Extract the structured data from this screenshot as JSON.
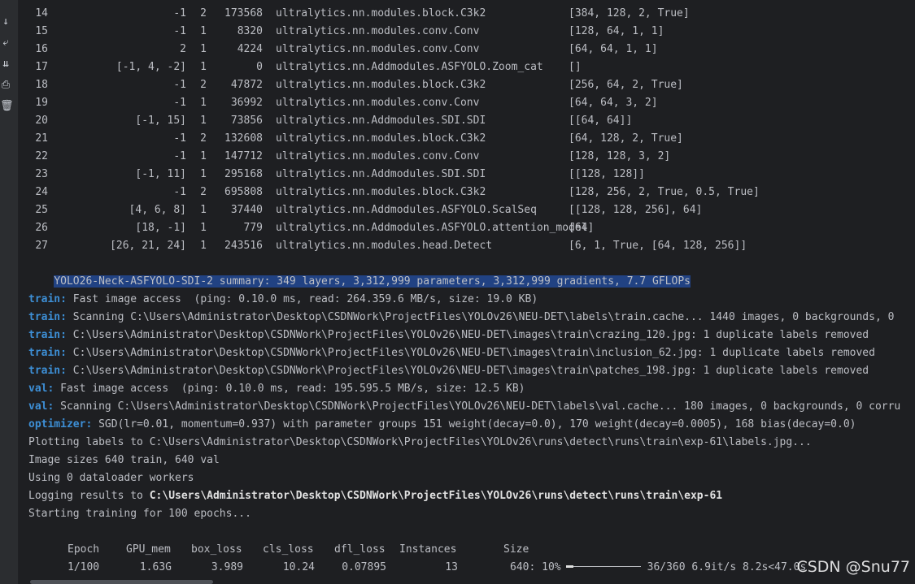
{
  "gutter_icons": [
    "arrow-down-icon",
    "wrap-lines-icon",
    "scroll-to-end-icon",
    "print-icon",
    "trash-icon"
  ],
  "model_rows": [
    {
      "idx": "14",
      "from": "-1",
      "n": "2",
      "params": "173568",
      "module": "ultralytics.nn.modules.block.C3k2",
      "args": "[384, 128, 2, True]"
    },
    {
      "idx": "15",
      "from": "-1",
      "n": "1",
      "params": "8320",
      "module": "ultralytics.nn.modules.conv.Conv",
      "args": "[128, 64, 1, 1]"
    },
    {
      "idx": "16",
      "from": "2",
      "n": "1",
      "params": "4224",
      "module": "ultralytics.nn.modules.conv.Conv",
      "args": "[64, 64, 1, 1]"
    },
    {
      "idx": "17",
      "from": "[-1, 4, -2]",
      "n": "1",
      "params": "0",
      "module": "ultralytics.nn.Addmodules.ASFYOLO.Zoom_cat",
      "args": "[]"
    },
    {
      "idx": "18",
      "from": "-1",
      "n": "2",
      "params": "47872",
      "module": "ultralytics.nn.modules.block.C3k2",
      "args": "[256, 64, 2, True]"
    },
    {
      "idx": "19",
      "from": "-1",
      "n": "1",
      "params": "36992",
      "module": "ultralytics.nn.modules.conv.Conv",
      "args": "[64, 64, 3, 2]"
    },
    {
      "idx": "20",
      "from": "[-1, 15]",
      "n": "1",
      "params": "73856",
      "module": "ultralytics.nn.Addmodules.SDI.SDI",
      "args": "[[64, 64]]"
    },
    {
      "idx": "21",
      "from": "-1",
      "n": "2",
      "params": "132608",
      "module": "ultralytics.nn.modules.block.C3k2",
      "args": "[64, 128, 2, True]"
    },
    {
      "idx": "22",
      "from": "-1",
      "n": "1",
      "params": "147712",
      "module": "ultralytics.nn.modules.conv.Conv",
      "args": "[128, 128, 3, 2]"
    },
    {
      "idx": "23",
      "from": "[-1, 11]",
      "n": "1",
      "params": "295168",
      "module": "ultralytics.nn.Addmodules.SDI.SDI",
      "args": "[[128, 128]]"
    },
    {
      "idx": "24",
      "from": "-1",
      "n": "2",
      "params": "695808",
      "module": "ultralytics.nn.modules.block.C3k2",
      "args": "[128, 256, 2, True, 0.5, True]"
    },
    {
      "idx": "25",
      "from": "[4, 6, 8]",
      "n": "1",
      "params": "37440",
      "module": "ultralytics.nn.Addmodules.ASFYOLO.ScalSeq",
      "args": "[[128, 128, 256], 64]"
    },
    {
      "idx": "26",
      "from": "[18, -1]",
      "n": "1",
      "params": "779",
      "module": "ultralytics.nn.Addmodules.ASFYOLO.attention_model",
      "args": "[64]"
    },
    {
      "idx": "27",
      "from": "[26, 21, 24]",
      "n": "1",
      "params": "243516",
      "module": "ultralytics.nn.modules.head.Detect",
      "args": "[6, 1, True, [64, 128, 256]]"
    }
  ],
  "summary": "YOLO26-Neck-ASFYOLO-SDI-2 summary: 349 layers, 3,312,999 parameters, 3,312,999 gradients, 7.7 GFLOPs",
  "log": [
    {
      "prefix": "train:",
      "text": " Fast image access  (ping: 0.10.0 ms, read: 264.359.6 MB/s, size: 19.0 KB)"
    },
    {
      "prefix": "train:",
      "text": " Scanning C:\\Users\\Administrator\\Desktop\\CSDNWork\\ProjectFiles\\YOLOv26\\NEU-DET\\labels\\train.cache... 1440 images, 0 backgrounds, 0"
    },
    {
      "prefix": "train:",
      "text": " C:\\Users\\Administrator\\Desktop\\CSDNWork\\ProjectFiles\\YOLOv26\\NEU-DET\\images\\train\\crazing_120.jpg: 1 duplicate labels removed"
    },
    {
      "prefix": "train:",
      "text": " C:\\Users\\Administrator\\Desktop\\CSDNWork\\ProjectFiles\\YOLOv26\\NEU-DET\\images\\train\\inclusion_62.jpg: 1 duplicate labels removed"
    },
    {
      "prefix": "train:",
      "text": " C:\\Users\\Administrator\\Desktop\\CSDNWork\\ProjectFiles\\YOLOv26\\NEU-DET\\images\\train\\patches_198.jpg: 1 duplicate labels removed"
    },
    {
      "prefix": "val:",
      "text": " Fast image access  (ping: 0.10.0 ms, read: 195.595.5 MB/s, size: 12.5 KB)"
    },
    {
      "prefix": "val:",
      "text": " Scanning C:\\Users\\Administrator\\Desktop\\CSDNWork\\ProjectFiles\\YOLOv26\\NEU-DET\\labels\\val.cache... 180 images, 0 backgrounds, 0 corru"
    },
    {
      "prefix": "optimizer:",
      "text": " SGD(lr=0.01, momentum=0.937) with parameter groups 151 weight(decay=0.0), 170 weight(decay=0.0005), 168 bias(decay=0.0)"
    },
    {
      "prefix": "",
      "text": "Plotting labels to C:\\Users\\Administrator\\Desktop\\CSDNWork\\ProjectFiles\\YOLOv26\\runs\\detect\\runs\\train\\exp-61\\labels.jpg..."
    },
    {
      "prefix": "",
      "text": "Image sizes 640 train, 640 val"
    },
    {
      "prefix": "",
      "text": "Using 0 dataloader workers"
    }
  ],
  "logging_label": "Logging results to ",
  "logging_path": "C:\\Users\\Administrator\\Desktop\\CSDNWork\\ProjectFiles\\YOLOv26\\runs\\detect\\runs\\train\\exp-61",
  "starting": "Starting training for 100 epochs...",
  "epoch_header": {
    "epoch": "Epoch",
    "gpu_mem": "GPU_mem",
    "box_loss": "box_loss",
    "cls_loss": "cls_loss",
    "dfl_loss": "dfl_loss",
    "instances": "Instances",
    "size": "Size"
  },
  "epoch_row": {
    "epoch": "1/100",
    "gpu_mem": "1.63G",
    "box_loss": "3.989",
    "cls_loss": "10.24",
    "dfl_loss": "0.07895",
    "instances": "13",
    "size": "640:",
    "pct": "10%",
    "progress": 0.1,
    "rest": "36/360 6.9it/s 8.2s<47.0s"
  },
  "watermark": "CSDN @Snu77"
}
